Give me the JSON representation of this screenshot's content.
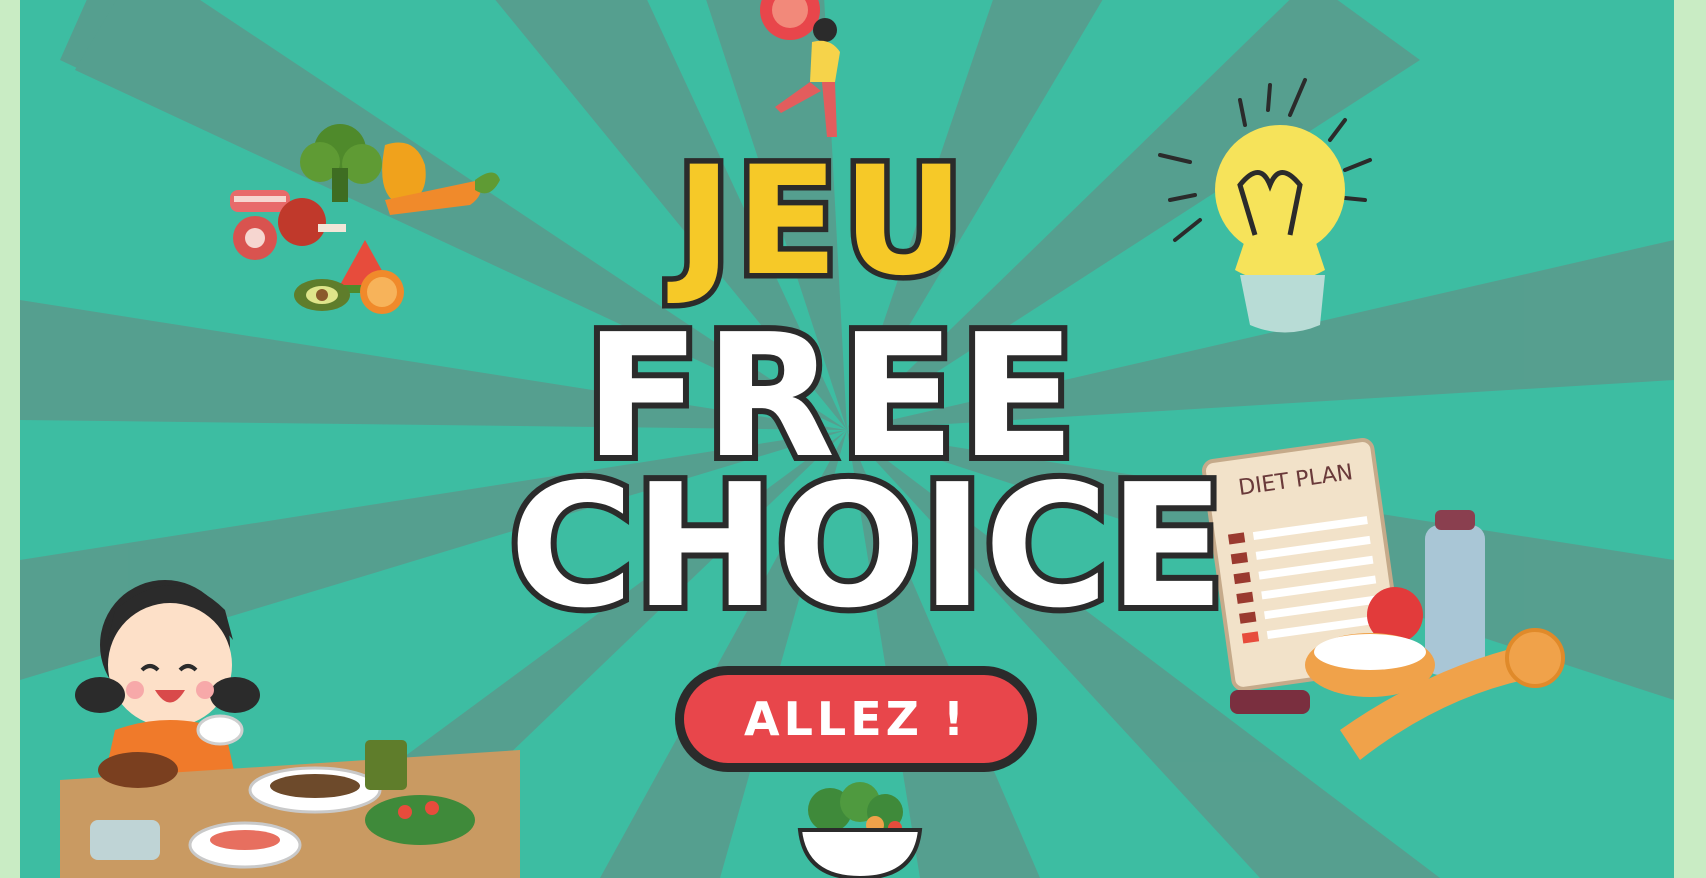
{
  "game": {
    "title_line1": "JEU",
    "title_line2": "FREE",
    "title_line3": "CHOICE",
    "start_button_label": "ALLEZ !",
    "clipboard_label": "DIET PLAN"
  },
  "colors": {
    "background": "#3dbda2",
    "rays": "#5a9a8c",
    "title_yellow": "#f6c928",
    "title_white": "#ffffff",
    "outline": "#2b2b2b",
    "button_red": "#e8464b",
    "side_border": "#c9ecc4"
  },
  "icons": [
    "vegetables-meat-icon",
    "lightbulb-icon",
    "girl-eating-icon",
    "diet-plan-icon",
    "salad-bowl-icon",
    "person-with-tomato-icon"
  ]
}
